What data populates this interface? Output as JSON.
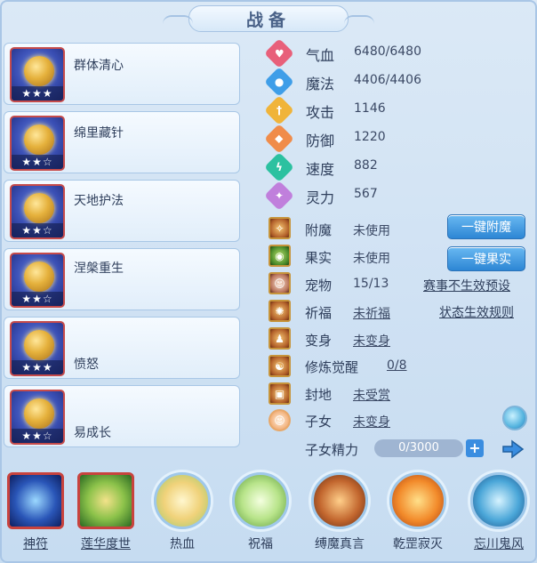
{
  "title": "战备",
  "cards": [
    {
      "name": "群体清心",
      "stars": "★★★",
      "art": "tiara-icon"
    },
    {
      "name": "绵里藏针",
      "stars": "★★☆",
      "art": "armor-icon"
    },
    {
      "name": "天地护法",
      "stars": "★★☆",
      "art": "armor-icon"
    },
    {
      "name": "涅槃重生",
      "stars": "★★☆",
      "art": "ring-icon"
    },
    {
      "name": "愤怒",
      "stars": "★★★",
      "art": "crown-icon"
    },
    {
      "name": "易成长",
      "stars": "★★☆",
      "art": "armor-icon"
    }
  ],
  "stats": [
    {
      "label": "气血",
      "value": "6480/6480",
      "icon": "heart-icon",
      "color": "#e8607a"
    },
    {
      "label": "魔法",
      "value": "4406/4406",
      "icon": "mana-icon",
      "color": "#3f9ee8"
    },
    {
      "label": "攻击",
      "value": "1146",
      "icon": "sword-icon",
      "color": "#f0b43a"
    },
    {
      "label": "防御",
      "value": "1220",
      "icon": "shield-icon",
      "color": "#f08c4a"
    },
    {
      "label": "速度",
      "value": "882",
      "icon": "lightning-icon",
      "color": "#2cc1a0"
    },
    {
      "label": "灵力",
      "value": "567",
      "icon": "spirit-icon",
      "color": "#c07fdc"
    }
  ],
  "subs": [
    {
      "label": "附魔",
      "value": "未使用",
      "underline": false
    },
    {
      "label": "果实",
      "value": "未使用",
      "underline": false
    },
    {
      "label": "宠物",
      "value": "15/13",
      "underline": false
    },
    {
      "label": "祈福",
      "value": "未祈福",
      "underline": true
    },
    {
      "label": "变身",
      "value": "未变身",
      "underline": true
    },
    {
      "label": "修炼觉醒",
      "value": "0/8",
      "underline": true
    },
    {
      "label": "封地",
      "value": "未受赏",
      "underline": true
    },
    {
      "label": "子女",
      "value": "未变身",
      "underline": true
    }
  ],
  "buttons": {
    "enchant": "一键附魔",
    "fruit": "一键果实"
  },
  "links": {
    "preset": "赛事不生效预设",
    "rules": "状态生效规则"
  },
  "child_energy": {
    "label": "子女精力",
    "value": "0/3000",
    "fraction": 0
  },
  "bottom": [
    {
      "label": "神符",
      "style": "square",
      "underline": true
    },
    {
      "label": "莲华度世",
      "style": "square",
      "underline": true
    },
    {
      "label": "热血",
      "style": "round",
      "underline": false
    },
    {
      "label": "祝福",
      "style": "round",
      "underline": false
    },
    {
      "label": "缚魔真言",
      "style": "round",
      "underline": false
    },
    {
      "label": "乾罡寂灭",
      "style": "round",
      "underline": false
    },
    {
      "label": "忘川鬼风",
      "style": "round",
      "underline": true
    }
  ]
}
